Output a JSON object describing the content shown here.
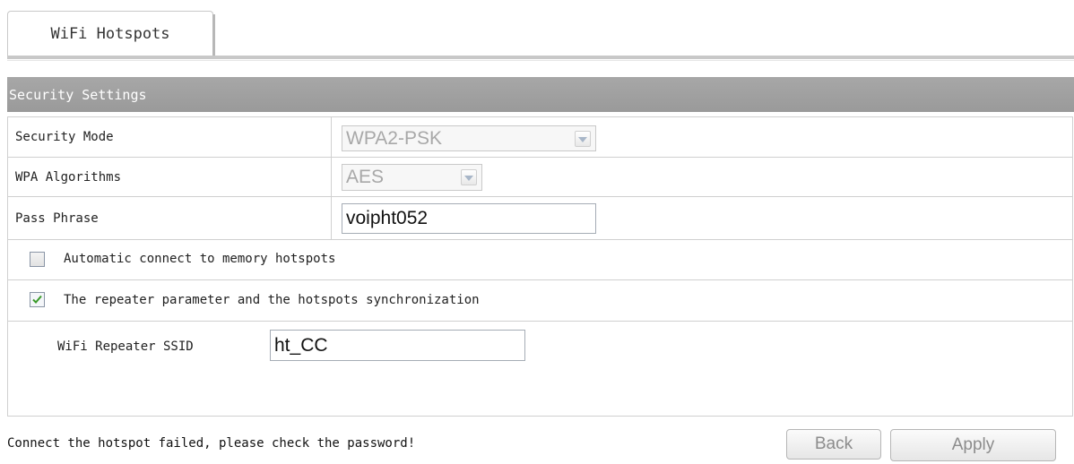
{
  "tabs": [
    {
      "label": "WiFi Hotspots"
    }
  ],
  "section": {
    "title": "Security Settings"
  },
  "form": {
    "security_mode": {
      "label": "Security Mode",
      "value": "WPA2-PSK"
    },
    "wpa_algorithms": {
      "label": "WPA Algorithms",
      "value": "AES"
    },
    "pass_phrase": {
      "label": "Pass Phrase",
      "value": "voipht052"
    },
    "auto_connect": {
      "label": "Automatic connect to memory hotspots",
      "checked": false
    },
    "repeater_sync": {
      "label": "The repeater parameter and the hotspots synchronization",
      "checked": true
    },
    "repeater_ssid": {
      "label": "WiFi Repeater SSID",
      "value": "ht_CC"
    }
  },
  "status": {
    "message": "Connect the hotspot failed, please check the password!"
  },
  "buttons": {
    "back": "Back",
    "apply": "Apply"
  },
  "colors": {
    "header_bg": "#9e9e9e",
    "border": "#d0d0d0",
    "check_mark": "#3a9a2a"
  }
}
